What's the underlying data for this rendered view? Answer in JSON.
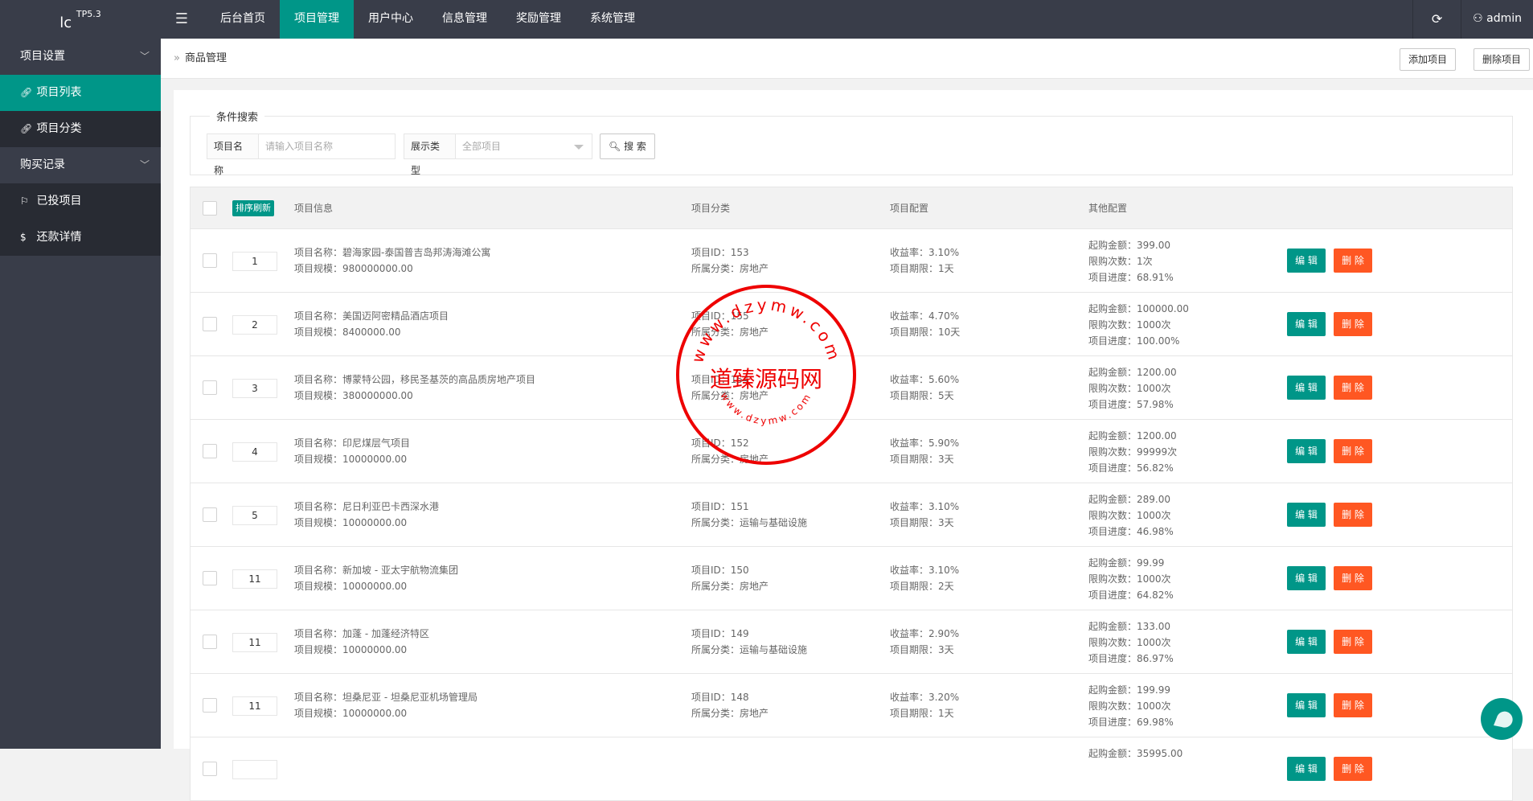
{
  "app": {
    "logo": "lc",
    "version": "TP5.3",
    "user": "admin"
  },
  "nav": [
    {
      "label": "后台首页"
    },
    {
      "label": "项目管理",
      "active": true
    },
    {
      "label": "用户中心"
    },
    {
      "label": "信息管理"
    },
    {
      "label": "奖励管理"
    },
    {
      "label": "系统管理"
    }
  ],
  "sidebar": {
    "groups": [
      {
        "label": "项目设置",
        "items": [
          {
            "label": "项目列表",
            "active": true
          },
          {
            "label": "项目分类"
          }
        ]
      },
      {
        "label": "购买记录",
        "items": [
          {
            "label": "已投项目"
          },
          {
            "label": "还款详情"
          }
        ]
      }
    ]
  },
  "breadcrumb": "商品管理",
  "actions": {
    "add": "添加项目",
    "delete": "删除项目"
  },
  "search": {
    "legend": "条件搜索",
    "name_label": "项目名称",
    "name_placeholder": "请输入项目名称",
    "type_label": "展示类型",
    "type_value": "全部项目",
    "button": "搜 索"
  },
  "table": {
    "sort_refresh": "排序刷新",
    "headers": [
      "项目信息",
      "项目分类",
      "项目配置",
      "其他配置"
    ],
    "edit_label": "编 辑",
    "delete_label": "删 除",
    "rows": [
      {
        "order": "1",
        "name": "项目名称：碧海家园-泰国普吉岛邦涛海滩公寓",
        "scale": "项目规模：980000000.00",
        "id": "项目ID：153",
        "cat": "所属分类：房地产",
        "rate": "收益率：3.10%",
        "period": "项目期限：1天",
        "min": "起购金额：399.00",
        "limit": "限购次数：1次",
        "progress": "项目进度：68.91%"
      },
      {
        "order": "2",
        "name": "项目名称：美国迈阿密精品酒店项目",
        "scale": "项目规模：8400000.00",
        "id": "项目ID：155",
        "cat": "所属分类：房地产",
        "rate": "收益率：4.70%",
        "period": "项目期限：10天",
        "min": "起购金额：100000.00",
        "limit": "限购次数：1000次",
        "progress": "项目进度：100.00%"
      },
      {
        "order": "3",
        "name": "项目名称：博蒙特公园，移民圣基茨的高品质房地产项目",
        "scale": "项目规模：380000000.00",
        "id": "项目ID：154",
        "cat": "所属分类：房地产",
        "rate": "收益率：5.60%",
        "period": "项目期限：5天",
        "min": "起购金额：1200.00",
        "limit": "限购次数：1000次",
        "progress": "项目进度：57.98%"
      },
      {
        "order": "4",
        "name": "项目名称：印尼煤层气项目",
        "scale": "项目规模：10000000.00",
        "id": "项目ID：152",
        "cat": "所属分类：房地产",
        "rate": "收益率：5.90%",
        "period": "项目期限：3天",
        "min": "起购金额：1200.00",
        "limit": "限购次数：99999次",
        "progress": "项目进度：56.82%"
      },
      {
        "order": "5",
        "name": "项目名称：尼日利亚巴卡西深水港",
        "scale": "项目规模：10000000.00",
        "id": "项目ID：151",
        "cat": "所属分类：运输与基础设施",
        "rate": "收益率：3.10%",
        "period": "项目期限：3天",
        "min": "起购金额：289.00",
        "limit": "限购次数：1000次",
        "progress": "项目进度：46.98%"
      },
      {
        "order": "11",
        "name": "项目名称：新加坡 - 亚太宇航物流集团",
        "scale": "项目规模：10000000.00",
        "id": "项目ID：150",
        "cat": "所属分类：房地产",
        "rate": "收益率：3.10%",
        "period": "项目期限：2天",
        "min": "起购金额：99.99",
        "limit": "限购次数：1000次",
        "progress": "项目进度：64.82%"
      },
      {
        "order": "11",
        "name": "项目名称：加蓬 - 加蓬经济特区",
        "scale": "项目规模：10000000.00",
        "id": "项目ID：149",
        "cat": "所属分类：运输与基础设施",
        "rate": "收益率：2.90%",
        "period": "项目期限：3天",
        "min": "起购金额：133.00",
        "limit": "限购次数：1000次",
        "progress": "项目进度：86.97%"
      },
      {
        "order": "11",
        "name": "项目名称：坦桑尼亚 - 坦桑尼亚机场管理局",
        "scale": "项目规模：10000000.00",
        "id": "项目ID：148",
        "cat": "所属分类：房地产",
        "rate": "收益率：3.20%",
        "period": "项目期限：1天",
        "min": "起购金额：199.99",
        "limit": "限购次数：1000次",
        "progress": "项目进度：69.98%"
      },
      {
        "order": "",
        "name": "",
        "scale": "",
        "id": "",
        "cat": "",
        "rate": "",
        "period": "",
        "min": "起购金额：35995.00",
        "limit": "",
        "progress": ""
      }
    ]
  },
  "watermark": {
    "text": "道臻源码网",
    "ring": "www.dzymw.com"
  },
  "colors": {
    "topbar": "#393d49",
    "accent": "#009688",
    "danger": "#ff5722",
    "sidebar_item": "#282b33"
  }
}
